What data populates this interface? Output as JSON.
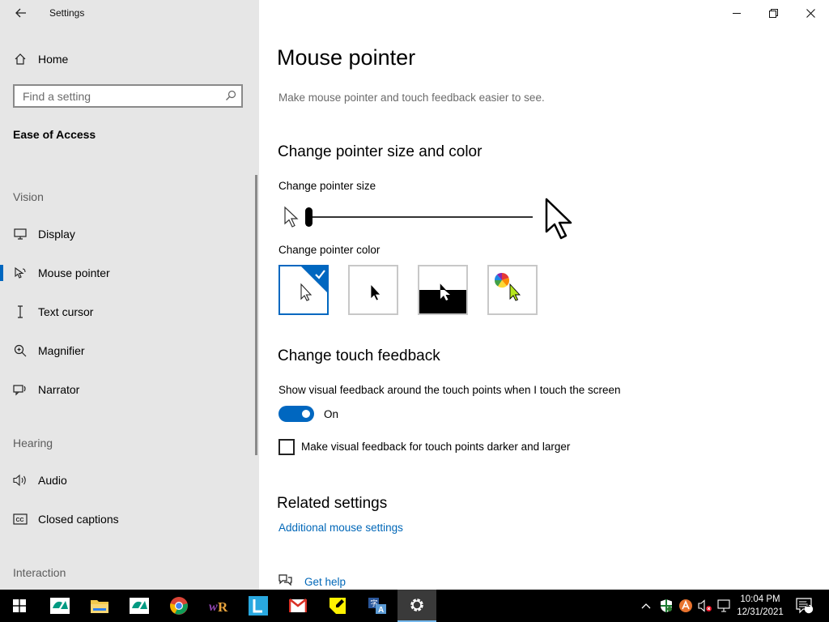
{
  "window": {
    "title": "Settings",
    "controls": [
      "minimize",
      "restore",
      "close"
    ]
  },
  "sidebar": {
    "home_label": "Home",
    "search_placeholder": "Find a setting",
    "category_title": "Ease of Access",
    "sections": [
      {
        "label": "Vision",
        "items": [
          {
            "label": "Display",
            "icon": "monitor-icon"
          },
          {
            "label": "Mouse pointer",
            "icon": "mouse-pointer-icon",
            "active": true
          },
          {
            "label": "Text cursor",
            "icon": "text-cursor-icon"
          },
          {
            "label": "Magnifier",
            "icon": "magnifier-icon"
          },
          {
            "label": "Narrator",
            "icon": "narrator-icon"
          }
        ]
      },
      {
        "label": "Hearing",
        "items": [
          {
            "label": "Audio",
            "icon": "speaker-icon"
          },
          {
            "label": "Closed captions",
            "icon": "closed-captions-icon"
          }
        ]
      },
      {
        "label": "Interaction",
        "items": []
      }
    ]
  },
  "main": {
    "page_title": "Mouse pointer",
    "description": "Make mouse pointer and touch feedback easier to see.",
    "size_color_heading": "Change pointer size and color",
    "pointer_size_label": "Change pointer size",
    "pointer_size_value": 1,
    "pointer_color_label": "Change pointer color",
    "color_options": [
      {
        "name": "white",
        "selected": true
      },
      {
        "name": "black",
        "selected": false
      },
      {
        "name": "inverted",
        "selected": false
      },
      {
        "name": "custom",
        "selected": false
      }
    ],
    "touch_heading": "Change touch feedback",
    "touch_feedback_label": "Show visual feedback around the touch points when I touch the screen",
    "toggle_state": "On",
    "darker_checkbox_label": "Make visual feedback for touch points darker and larger",
    "darker_checkbox_checked": false,
    "related_heading": "Related settings",
    "related_link": "Additional mouse settings",
    "help_link": "Get help"
  },
  "taskbar": {
    "apps": [
      "start",
      "credit-agricole",
      "file-explorer",
      "credit-agricole-2",
      "chrome",
      "winrar",
      "libreoffice",
      "gmail",
      "sticky-notes",
      "translator",
      "settings"
    ],
    "time": "10:04 PM",
    "date": "12/31/2021",
    "notification_count": "1"
  },
  "colors": {
    "accent": "#0067c0",
    "link": "#0067b8",
    "sidebar_bg": "#e6e6e6",
    "taskbar_bg": "#000000"
  }
}
